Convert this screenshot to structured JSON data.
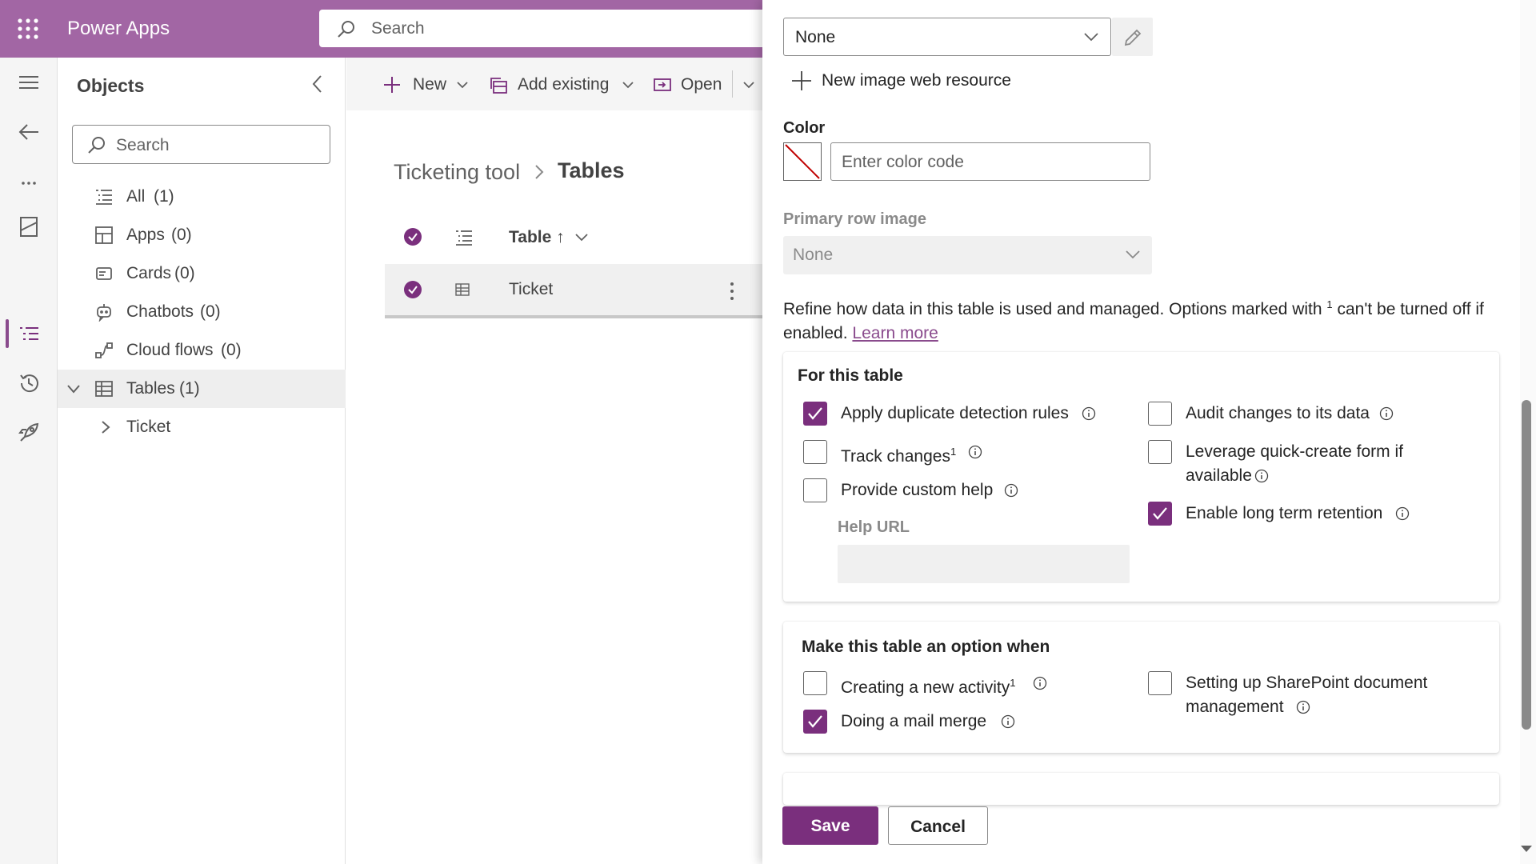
{
  "header": {
    "app_name": "Power Apps",
    "search_placeholder": "Search",
    "background": "#a266a4"
  },
  "objects": {
    "title": "Objects",
    "search_placeholder": "Search",
    "items": [
      {
        "label": "All",
        "count": "(1)",
        "icon": "list-icon"
      },
      {
        "label": "Apps",
        "count": "(0)",
        "icon": "apps-icon"
      },
      {
        "label": "Cards",
        "count": "(0)",
        "icon": "cards-icon"
      },
      {
        "label": "Chatbots",
        "count": "(0)",
        "icon": "chatbot-icon"
      },
      {
        "label": "Cloud flows",
        "count": "(0)",
        "icon": "flow-icon"
      },
      {
        "label": "Tables",
        "count": "(1)",
        "icon": "table-icon",
        "expanded": true
      },
      {
        "label": "Ticket",
        "icon": "chevron-right-icon"
      }
    ]
  },
  "toolbar": {
    "new_label": "New",
    "add_existing_label": "Add existing",
    "open_label": "Open"
  },
  "breadcrumb": {
    "root": "Ticketing tool",
    "current": "Tables"
  },
  "table": {
    "column_header": "Table ↑",
    "rows": [
      {
        "name": "Ticket",
        "selected": true
      }
    ]
  },
  "panel": {
    "image_dropdown_value": "None",
    "new_image_label": "New image web resource",
    "color_label": "Color",
    "color_placeholder": "Enter color code",
    "primary_image_label": "Primary row image",
    "primary_image_value": "None",
    "refine_text": "Refine how data in this table is used and managed. Options marked with",
    "refine_sup": "1",
    "refine_text2": "can't be turned off if enabled.",
    "learn_more": "Learn more",
    "for_this_table": {
      "title": "For this table",
      "options": {
        "duplicate": {
          "label": "Apply duplicate detection rules",
          "checked": true
        },
        "track": {
          "label": "Track changes",
          "sup": "1",
          "checked": false
        },
        "custom_help": {
          "label": "Provide custom help",
          "checked": false
        },
        "audit": {
          "label": "Audit changes to its data",
          "checked": false
        },
        "quick_create_line1": "Leverage quick-create form if",
        "quick_create_line2": "available",
        "retention": {
          "label": "Enable long term retention",
          "checked": true
        }
      },
      "help_url_label": "Help URL"
    },
    "option_when": {
      "title": "Make this table an option when",
      "activity": {
        "label": "Creating a new activity",
        "sup": "1",
        "checked": false
      },
      "mail_merge": {
        "label": "Doing a mail merge",
        "checked": true
      },
      "sharepoint_line1": "Setting up SharePoint document",
      "sharepoint_line2": "management"
    },
    "save_label": "Save",
    "cancel_label": "Cancel",
    "accent": "#7a2f7d"
  }
}
